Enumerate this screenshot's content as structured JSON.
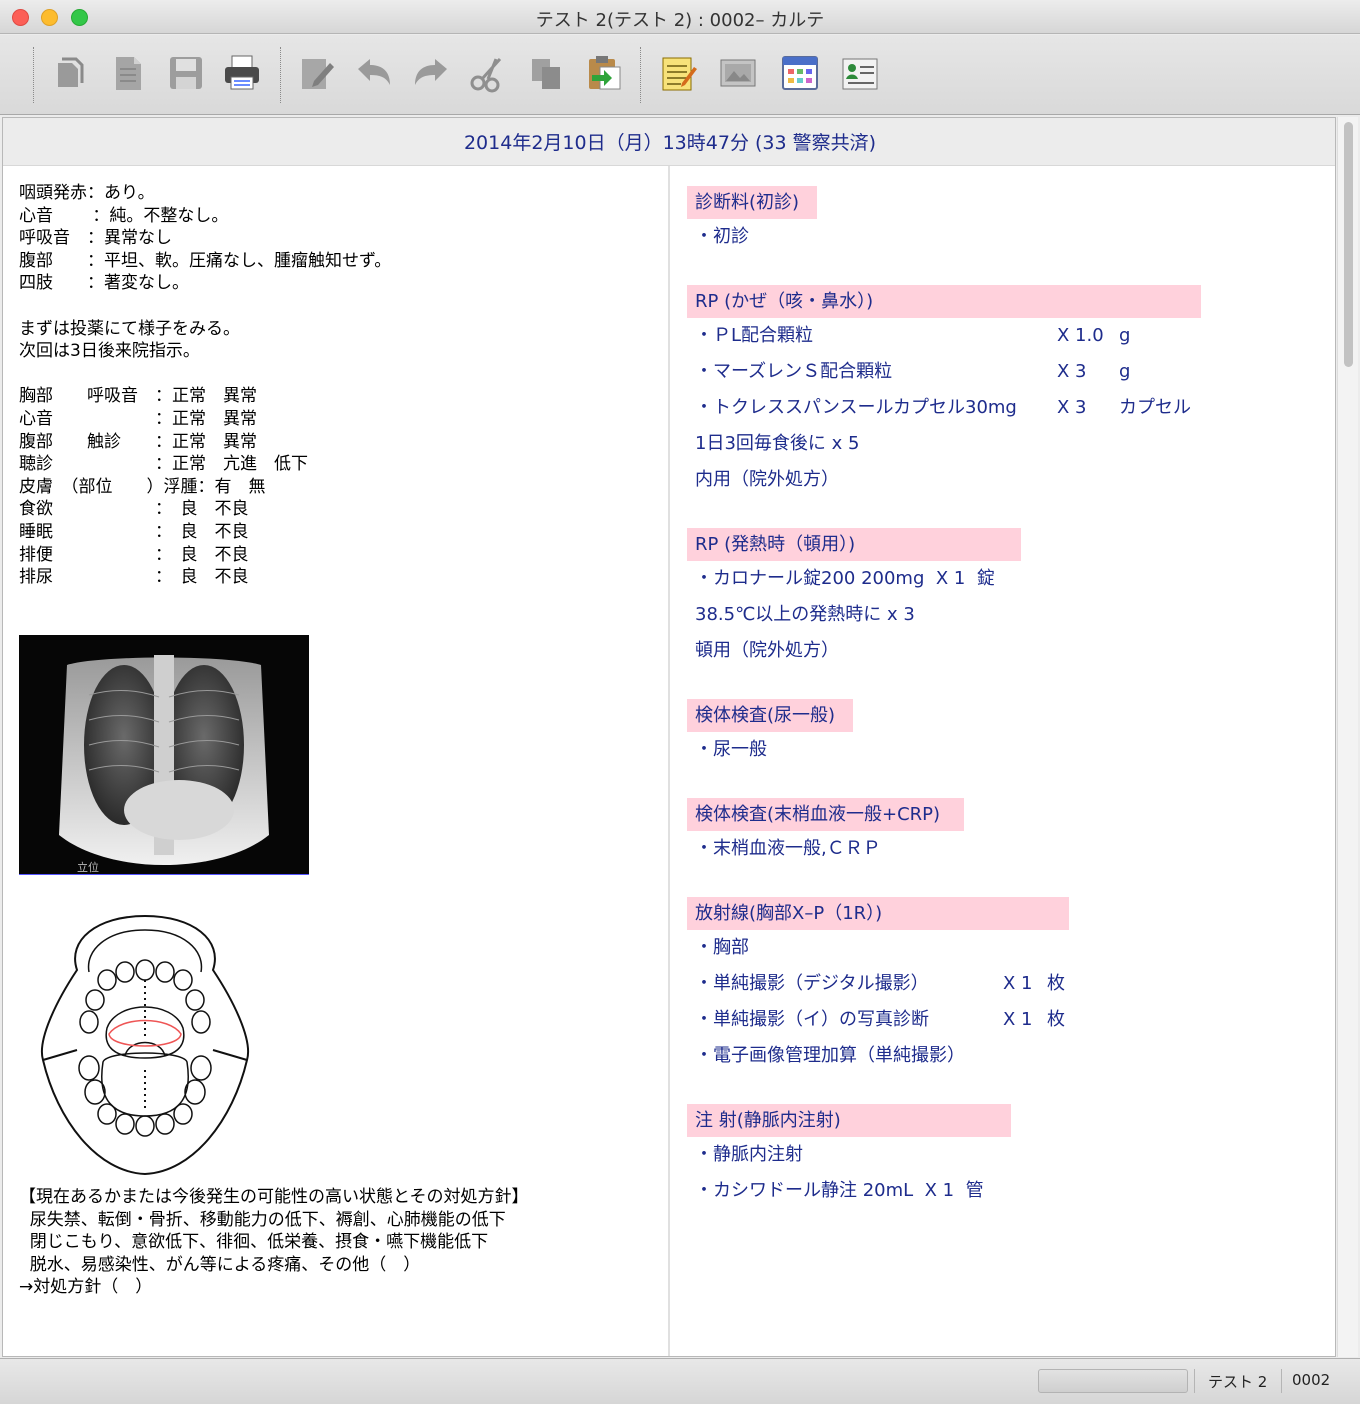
{
  "window": {
    "title": "テスト 2(テスト 2) : 0002– カルテ"
  },
  "toolbar": {
    "buttons": [
      {
        "name": "new-karte-icon"
      },
      {
        "name": "new-document-icon"
      },
      {
        "name": "save-icon"
      },
      {
        "name": "print-icon"
      },
      {
        "name": "edit-icon"
      },
      {
        "name": "undo-icon"
      },
      {
        "name": "redo-icon"
      },
      {
        "name": "cut-icon"
      },
      {
        "name": "copy-icon"
      },
      {
        "name": "paste-icon"
      },
      {
        "name": "stamp-note-icon"
      },
      {
        "name": "image-icon"
      },
      {
        "name": "calendar-icon"
      },
      {
        "name": "patient-card-icon"
      }
    ]
  },
  "header": {
    "date": "2014年2月10日（月）13時47分 (33 警察共済)"
  },
  "soa": {
    "lines": [
      "咽頭発赤：あり。",
      "心音　　 ：純。不整なし。",
      "呼吸音　：異常なし",
      "腹部　　：平坦、軟。圧痛なし、腫瘤触知せず。",
      "四肢　　：著変なし。",
      "",
      "まずは投薬にて様子をみる。",
      "次回は3日後来院指示。",
      "",
      "胸部　　呼吸音　：正常　異常",
      "心音　　　　　　：正常　異常",
      "腹部　　触診　　：正常　異常",
      "聴診　　　　　　：正常　亢進　低下",
      "皮膚　（部位　　）浮腫：有　無",
      "食欲　　　　　　：　良　不良",
      "睡眠　　　　　　：　良　不良",
      "排便　　　　　　：　良　不良",
      "排尿　　　　　　：　良　不良"
    ],
    "xray_label": "立位",
    "notes": [
      "【現在あるかまたは今後発生の可能性の高い状態とその対処方針】",
      "  尿失禁、転倒・骨折、移動能力の低下、褥創、心肺機能の低下",
      "  閉じこもり、意欲低下、徘徊、低栄養、摂食・嚥下機能低下",
      "  脱水、易感染性、がん等による疼痛、その他（　）",
      "→対処方針（　）"
    ]
  },
  "plan": {
    "sections": [
      {
        "title": "診断料(初診)",
        "width": 130,
        "items": [
          {
            "text": "・初診"
          }
        ]
      },
      {
        "title": "RP (かぜ（咳・鼻水）)",
        "width": 514,
        "items": [
          {
            "text": "・ＰL配合顆粒",
            "qty": "X 1.0",
            "unit": "g"
          },
          {
            "text": "・マーズレンＳ配合顆粒",
            "qty": "X 3",
            "unit": "g"
          },
          {
            "text": "・トクレススパンスールカプセル30mg",
            "qty": "X 3",
            "unit": "カプセル"
          },
          {
            "text": "1日3回毎食後に x 5",
            "noindent": true
          },
          {
            "text": "内用（院外処方）",
            "noindent": true
          }
        ]
      },
      {
        "title": "RP (発熱時（頓用）)",
        "width": 334,
        "items": [
          {
            "text": "・カロナール錠200 200mg  X 1  錠"
          },
          {
            "text": "38.5℃以上の発熱時に x 3",
            "noindent": true
          },
          {
            "text": "頓用（院外処方）",
            "noindent": true
          }
        ]
      },
      {
        "title": "検体検査(尿一般)",
        "width": 166,
        "items": [
          {
            "text": "・尿一般"
          }
        ]
      },
      {
        "title": "検体検査(末梢血液一般+CRP)",
        "width": 277,
        "items": [
          {
            "text": "・末梢血液一般,ＣＲＰ"
          }
        ]
      },
      {
        "title": "放射線(胸部X–P（1R）)",
        "width": 382,
        "items": [
          {
            "text": "・胸部"
          },
          {
            "text": "・単純撮影（デジタル撮影）",
            "qty": "X 1",
            "unit": "枚"
          },
          {
            "text": "・単純撮影（イ）の写真診断",
            "qty": "X 1",
            "unit": "枚"
          },
          {
            "text": "・電子画像管理加算（単純撮影）"
          }
        ]
      },
      {
        "title": "注 射(静脈内注射)",
        "width": 324,
        "items": [
          {
            "text": "・静脈内注射"
          },
          {
            "text": "・カシワドール静注 20mL  X 1  管"
          }
        ]
      }
    ]
  },
  "status": {
    "patient_name": "テスト 2",
    "patient_id": "0002",
    "progress": 0
  }
}
